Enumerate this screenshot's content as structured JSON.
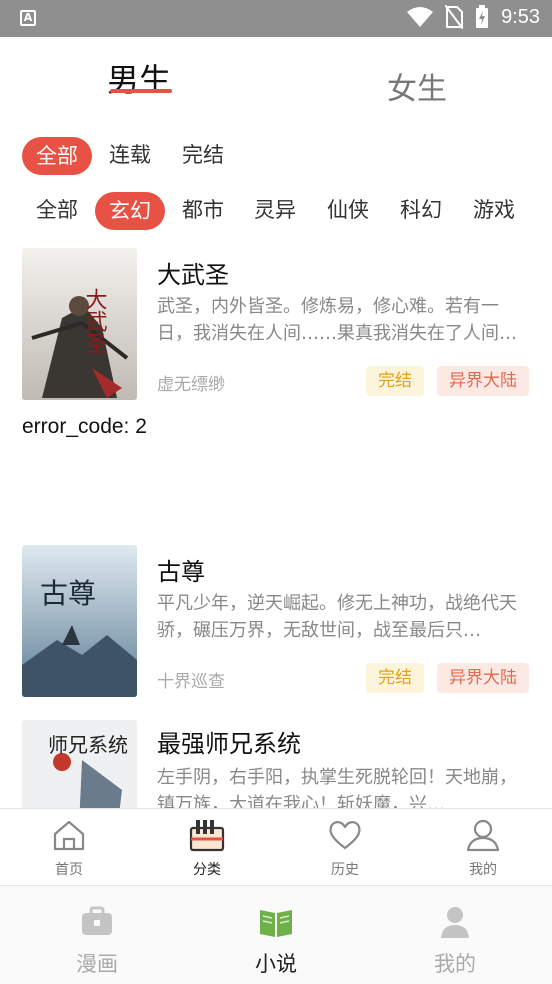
{
  "status_bar": {
    "time": "9:53"
  },
  "gender_tabs": [
    {
      "label": "男生",
      "active": true
    },
    {
      "label": "女生",
      "active": false
    }
  ],
  "status_filters": [
    {
      "label": "全部",
      "active": true
    },
    {
      "label": "连载",
      "active": false
    },
    {
      "label": "完结",
      "active": false
    }
  ],
  "category_filters": [
    {
      "label": "全部",
      "active": false
    },
    {
      "label": "玄幻",
      "active": true
    },
    {
      "label": "都市",
      "active": false
    },
    {
      "label": "灵异",
      "active": false
    },
    {
      "label": "仙侠",
      "active": false
    },
    {
      "label": "科幻",
      "active": false
    },
    {
      "label": "游戏",
      "active": false
    }
  ],
  "books": [
    {
      "title": "大武圣",
      "description": "武圣，内外皆圣。修炼易，修心难。若有一日，我消失在人间……果真我消失在了人间…",
      "author": "虚无缥缈",
      "status": "完结",
      "genre": "异界大陆",
      "cover_text": "大武圣"
    },
    {
      "title": "古尊",
      "description": "平凡少年，逆天崛起。修无上神功，战绝代天骄，碾压万界，无敌世间，战至最后只…",
      "author": "十界巡查",
      "status": "完结",
      "genre": "异界大陆",
      "cover_text": "古尊"
    },
    {
      "title": "最强师兄系统",
      "description": "左手阴，右手阳，执掌生死脱轮回！天地崩，镇万族，大道在我心！斩妖魔，兴…",
      "author": "",
      "status": "",
      "genre": "",
      "cover_text": "师兄系统"
    }
  ],
  "error_message": "error_code: 2",
  "inner_nav": [
    {
      "label": "首页",
      "icon": "home-icon",
      "active": false
    },
    {
      "label": "分类",
      "icon": "category-icon",
      "active": true
    },
    {
      "label": "历史",
      "icon": "heart-icon",
      "active": false
    },
    {
      "label": "我的",
      "icon": "user-icon",
      "active": false
    }
  ],
  "outer_nav": [
    {
      "label": "漫画",
      "icon": "briefcase-icon",
      "active": false
    },
    {
      "label": "小说",
      "icon": "book-icon",
      "active": true
    },
    {
      "label": "我的",
      "icon": "person-icon",
      "active": false
    }
  ],
  "colors": {
    "accent": "#e85245",
    "status_tag_bg": "#fdf4dc",
    "status_tag_text": "#e0a21a",
    "genre_tag_bg": "#fde9e3",
    "genre_tag_text": "#e46a4e",
    "active_nav_icon": "#6fb04a"
  }
}
